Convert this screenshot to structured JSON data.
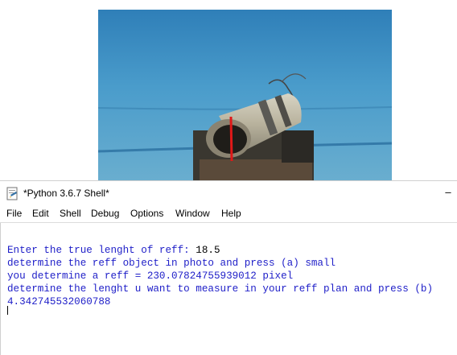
{
  "window": {
    "title": "*Python 3.6.7 Shell*",
    "minimize_glyph": "–"
  },
  "menu": [
    "File",
    "Edit",
    "Shell",
    "Debug",
    "Options",
    "Window",
    "Help"
  ],
  "shell": {
    "lines": [
      {
        "prompt": "Enter the true lenght of reff: ",
        "input": "18.5"
      },
      {
        "text": "determine the reff object in photo and press (a) small"
      },
      {
        "text": "you determine a reff = 230.07824755939012 pixel"
      },
      {
        "text": "determine the lenght u want to measure in your reff plan and press (b)"
      },
      {
        "text": "4.342745532060788"
      }
    ]
  },
  "colors": {
    "output_text": "#1e1ec8",
    "user_input": "#000000",
    "pool_water": "#3d8fc0",
    "measure_line": "#e01818"
  },
  "icons": {
    "app": "python-idle-shell-icon"
  }
}
